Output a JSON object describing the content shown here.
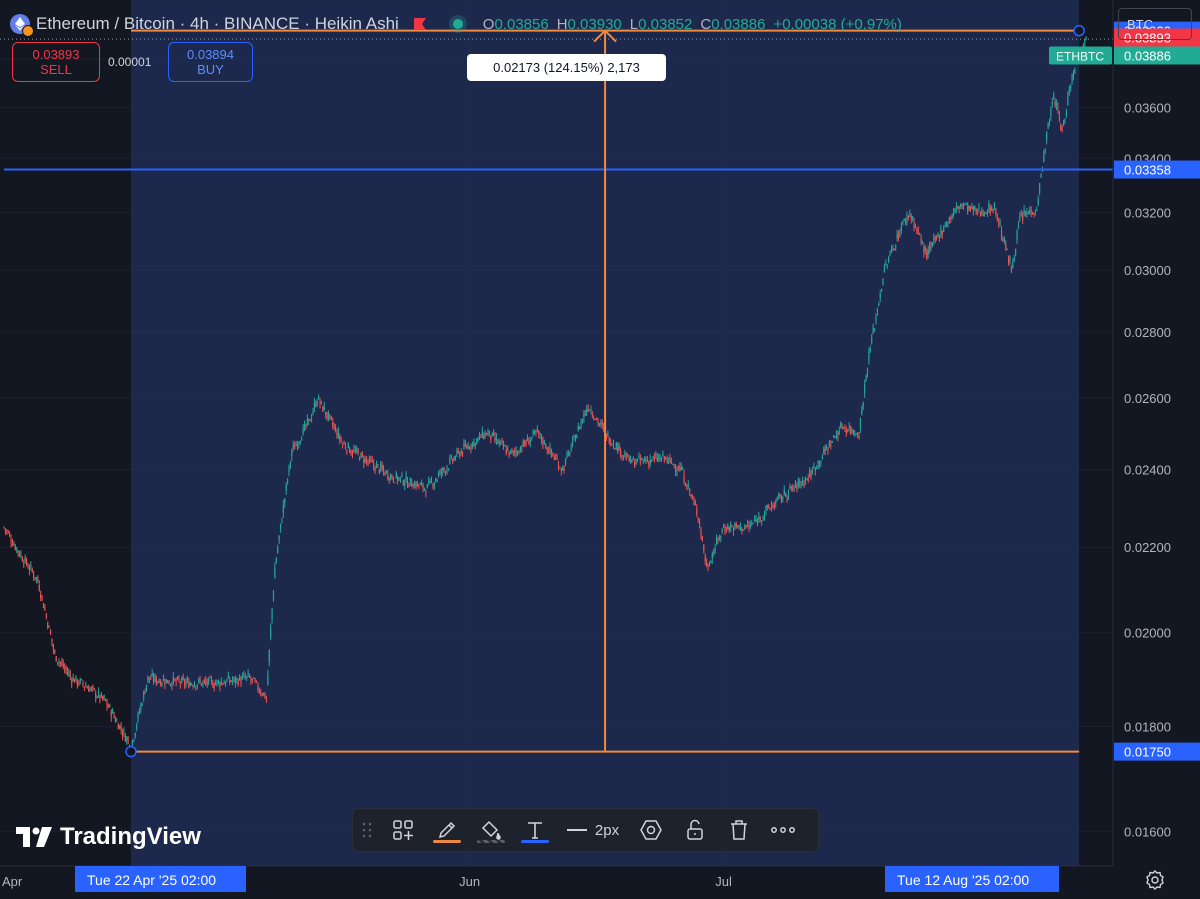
{
  "header": {
    "title": "Ethereum / Bitcoin · 4h · BINANCE · Heikin Ashi",
    "ohlc": [
      {
        "k": "O",
        "v": "0.03856"
      },
      {
        "k": "H",
        "v": "0.03930"
      },
      {
        "k": "L",
        "v": "0.03852"
      },
      {
        "k": "C",
        "v": "0.03886"
      }
    ],
    "change": "+0.00038 (+0.97%)"
  },
  "trade": {
    "sell_price": "0.03893",
    "sell_label": "SELL",
    "spread": "0.00001",
    "buy_price": "0.03894",
    "buy_label": "BUY"
  },
  "symbol_button": "BTC",
  "measure_label": "0.02173 (124.15%) 2,173",
  "logo_text": "TradingView",
  "toolbar": {
    "line_width_label": "2px"
  },
  "colors": {
    "background": "#131722",
    "up": "#26a69a",
    "down": "#ef5350",
    "measure": "#f0883e",
    "horizontal_line": "#2962ff",
    "range_fill": "#1e2d55"
  },
  "chart_data": {
    "type": "candlestick",
    "series_type": "Heikin Ashi",
    "symbol": "ETHBTC",
    "interval": "4h",
    "exchange": "BINANCE",
    "y_scale": "log",
    "ylim": [
      0.0155,
      0.0397
    ],
    "y_ticks": [
      "0.03800",
      "0.03600",
      "0.03400",
      "0.03200",
      "0.03000",
      "0.02800",
      "0.02600",
      "0.02400",
      "0.02200",
      "0.02000",
      "0.01800",
      "0.01600"
    ],
    "x_ticks": [
      "Jun",
      "Jul"
    ],
    "x_edge_labels": [
      "Apr",
      "Aug"
    ],
    "price_labels": {
      "measure_high": "0.03923",
      "ask": "0.03893",
      "last": "0.03886",
      "last_symbol": "ETHBTC",
      "horizontal_line": "0.03358",
      "measure_low": "0.01750"
    },
    "horizontal_line": 0.03358,
    "measure": {
      "from_date": "Tue 22 Apr '25",
      "from_time": "02:00",
      "to_date": "Tue 12 Aug '25",
      "to_time": "02:00",
      "from_price": 0.0175,
      "to_price": 0.03923,
      "change": "0.02173",
      "percent": "124.15%",
      "ticks": "2,173"
    },
    "x_range": [
      "2025-04-07",
      "2025-08-16"
    ],
    "path": [
      [
        "2025-04-07",
        0.0225
      ],
      [
        "2025-04-09",
        0.0218
      ],
      [
        "2025-04-11",
        0.0212
      ],
      [
        "2025-04-13",
        0.0195
      ],
      [
        "2025-04-15",
        0.019
      ],
      [
        "2025-04-17",
        0.0188
      ],
      [
        "2025-04-19",
        0.0185
      ],
      [
        "2025-04-22",
        0.0176
      ],
      [
        "2025-04-24",
        0.019
      ],
      [
        "2025-04-28",
        0.0189
      ],
      [
        "2025-05-02",
        0.0189
      ],
      [
        "2025-05-06",
        0.019
      ],
      [
        "2025-05-08",
        0.0186
      ],
      [
        "2025-05-09",
        0.0215
      ],
      [
        "2025-05-10",
        0.023
      ],
      [
        "2025-05-11",
        0.0245
      ],
      [
        "2025-05-13",
        0.0253
      ],
      [
        "2025-05-14",
        0.026
      ],
      [
        "2025-05-17",
        0.0247
      ],
      [
        "2025-05-20",
        0.0242
      ],
      [
        "2025-05-23",
        0.0238
      ],
      [
        "2025-05-27",
        0.0235
      ],
      [
        "2025-05-31",
        0.0245
      ],
      [
        "2025-06-03",
        0.025
      ],
      [
        "2025-06-06",
        0.0244
      ],
      [
        "2025-06-09",
        0.025
      ],
      [
        "2025-06-12",
        0.024
      ],
      [
        "2025-06-15",
        0.0258
      ],
      [
        "2025-06-17",
        0.025
      ],
      [
        "2025-06-20",
        0.0242
      ],
      [
        "2025-06-24",
        0.0243
      ],
      [
        "2025-06-26",
        0.024
      ],
      [
        "2025-06-28",
        0.0228
      ],
      [
        "2025-06-29",
        0.0215
      ],
      [
        "2025-07-01",
        0.0225
      ],
      [
        "2025-07-04",
        0.0225
      ],
      [
        "2025-07-08",
        0.0233
      ],
      [
        "2025-07-11",
        0.0238
      ],
      [
        "2025-07-13",
        0.0245
      ],
      [
        "2025-07-15",
        0.0252
      ],
      [
        "2025-07-17",
        0.025
      ],
      [
        "2025-07-18",
        0.027
      ],
      [
        "2025-07-20",
        0.03
      ],
      [
        "2025-07-22",
        0.0315
      ],
      [
        "2025-07-23",
        0.032
      ],
      [
        "2025-07-25",
        0.0305
      ],
      [
        "2025-07-27",
        0.0315
      ],
      [
        "2025-07-29",
        0.0323
      ],
      [
        "2025-07-31",
        0.032
      ],
      [
        "2025-08-02",
        0.0322
      ],
      [
        "2025-08-04",
        0.03
      ],
      [
        "2025-08-05",
        0.0318
      ],
      [
        "2025-08-07",
        0.0322
      ],
      [
        "2025-08-08",
        0.0345
      ],
      [
        "2025-08-09",
        0.0365
      ],
      [
        "2025-08-10",
        0.035
      ],
      [
        "2025-08-11",
        0.037
      ],
      [
        "2025-08-12",
        0.0385
      ],
      [
        "2025-08-13",
        0.0389
      ]
    ]
  }
}
